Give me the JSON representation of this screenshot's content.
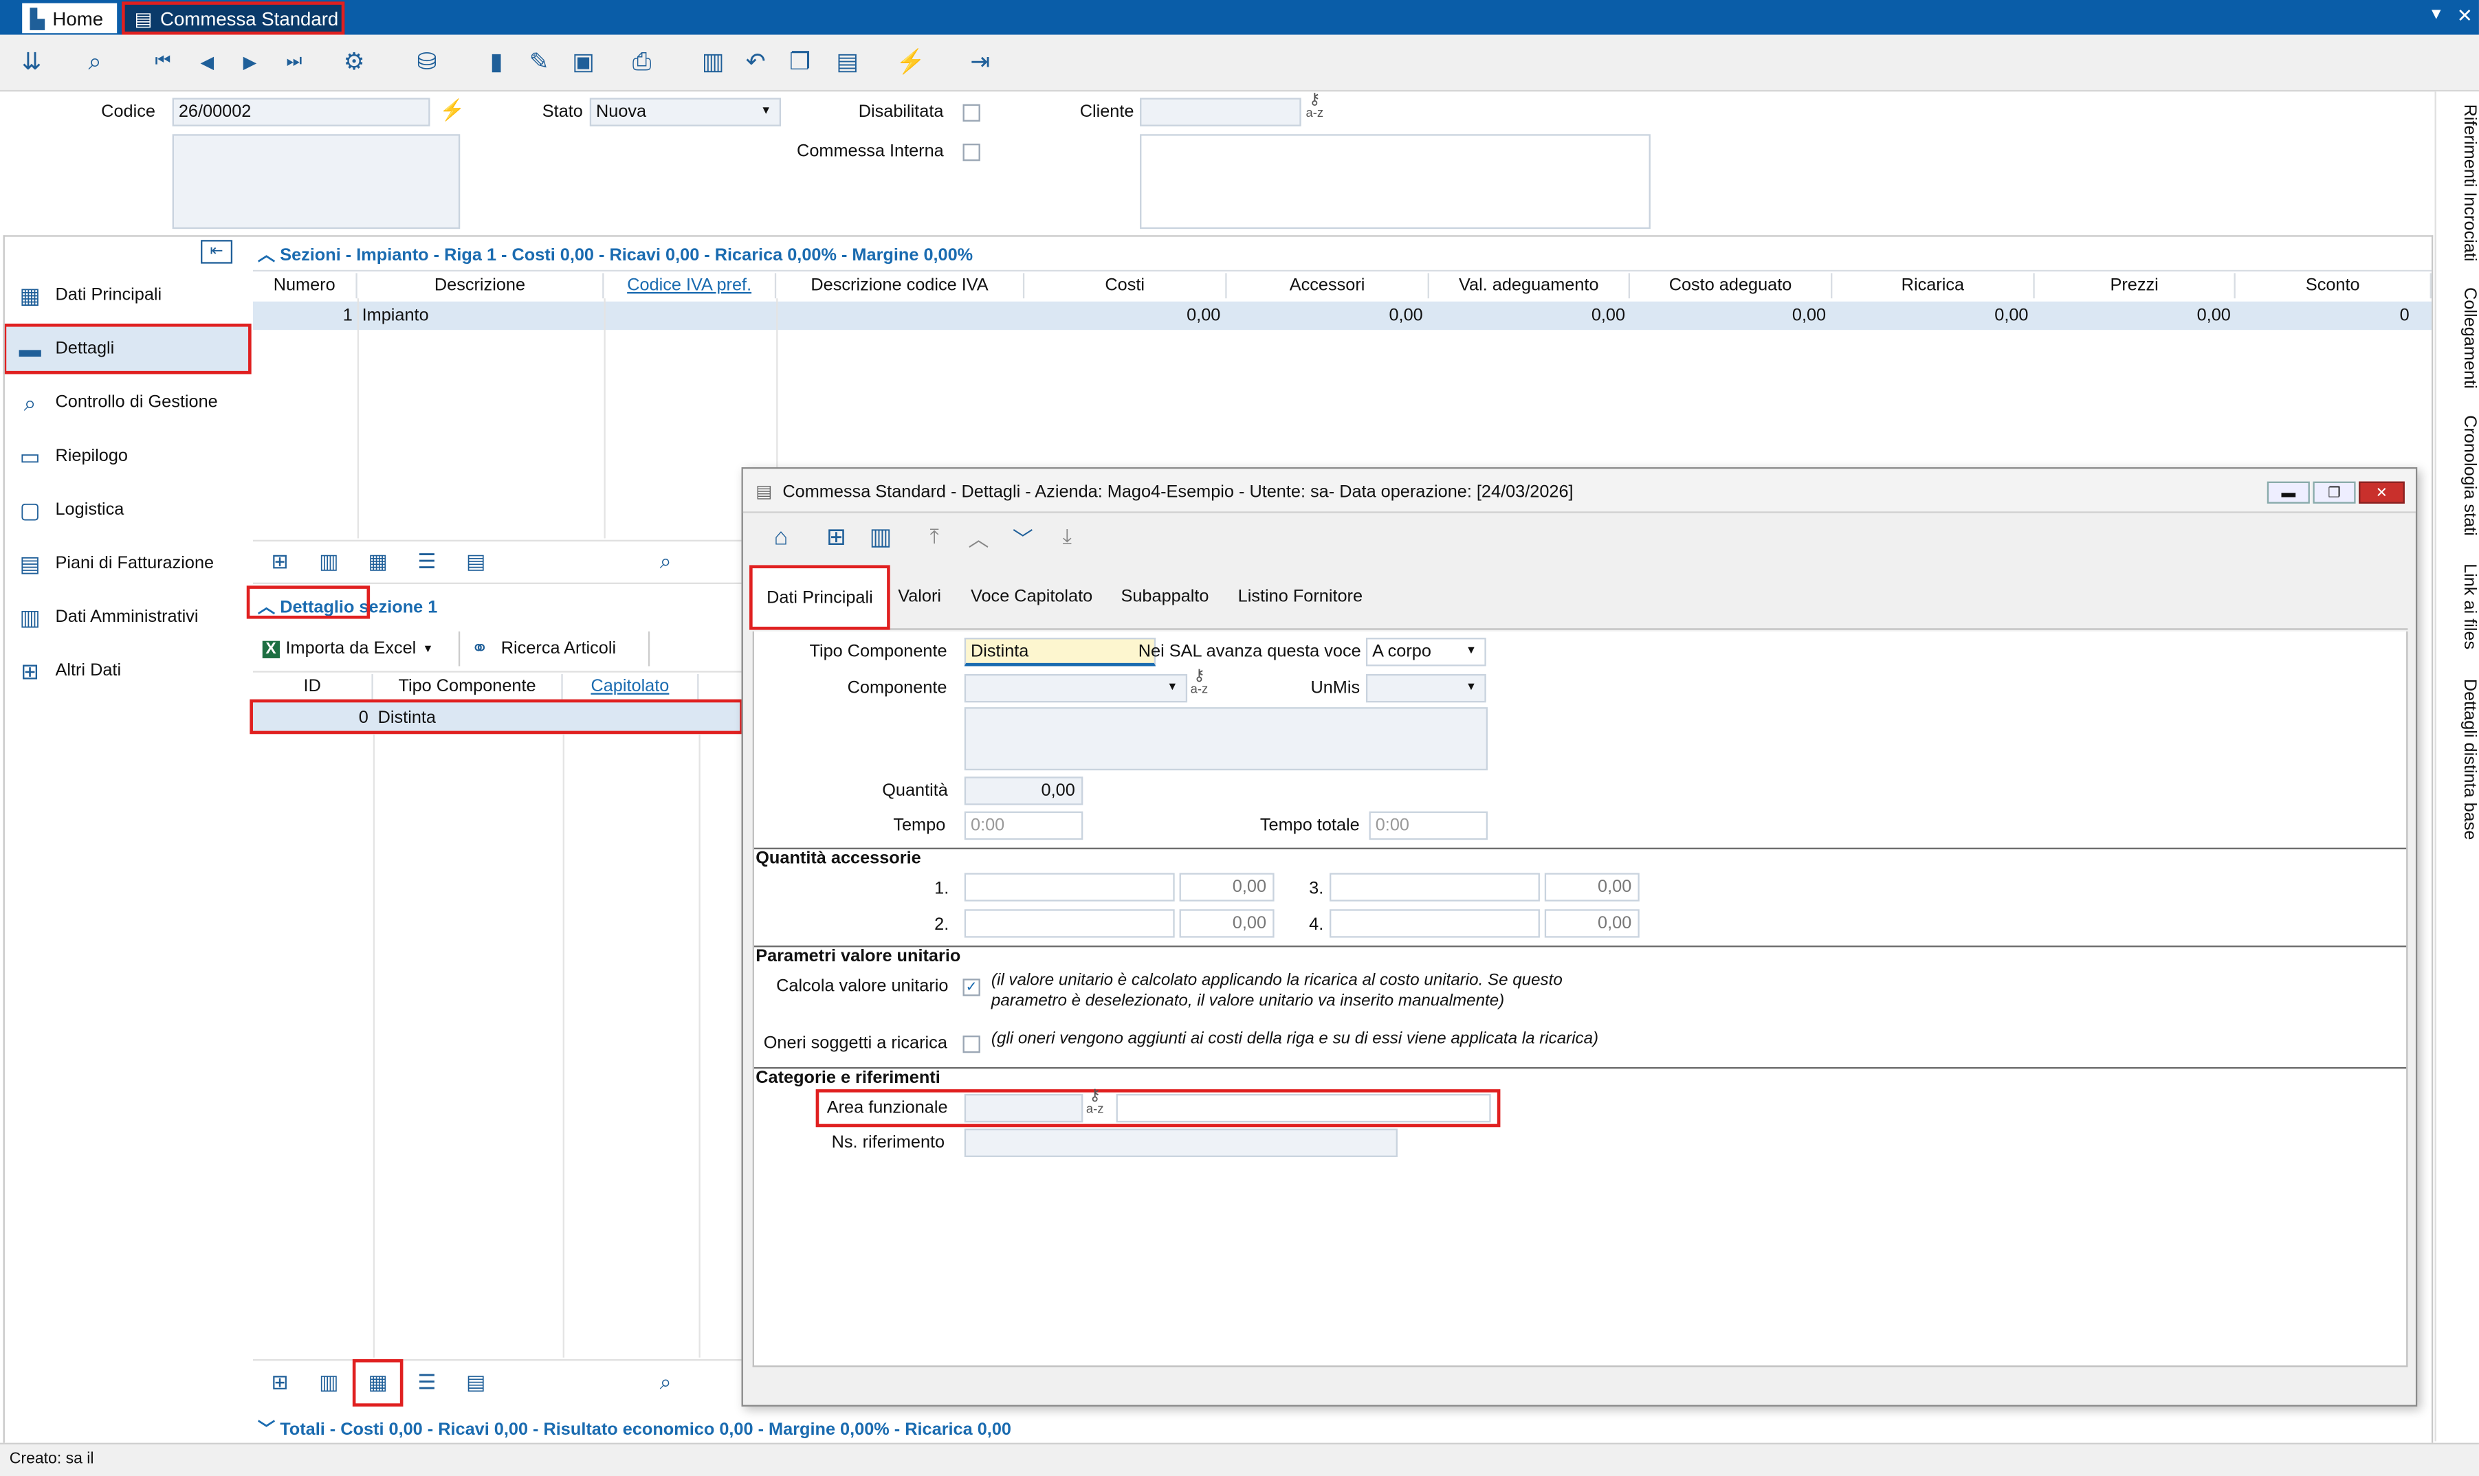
{
  "tabs": {
    "home": "Home",
    "active": "Commessa Standard"
  },
  "header": {
    "codice_label": "Codice",
    "codice_value": "26/00002",
    "stato_label": "Stato",
    "stato_value": "Nuova",
    "disabilitata_label": "Disabilitata",
    "commessa_interna_label": "Commessa Interna",
    "cliente_label": "Cliente",
    "az_label": "a-z"
  },
  "nav": {
    "items": [
      "Dati Principali",
      "Dettagli",
      "Controllo di Gestione",
      "Riepilogo",
      "Logistica",
      "Piani di Fatturazione",
      "Dati Amministrativi",
      "Altri Dati"
    ]
  },
  "sezioni": {
    "title": "Sezioni - Impianto - Riga 1 - Costi 0,00 - Ricavi 0,00 - Ricarica 0,00% - Margine 0,00%",
    "columns": [
      "Numero",
      "Descrizione",
      "Codice IVA pref.",
      "Descrizione codice IVA",
      "Costi",
      "Accessori",
      "Val. adeguamento",
      "Costo adeguato",
      "Ricarica",
      "Prezzi",
      "Sconto"
    ],
    "row": {
      "numero": "1",
      "descrizione": "Impianto",
      "costi": "0,00",
      "accessori": "0,00",
      "val_adeguamento": "0,00",
      "costo_adeguato": "0,00",
      "ricarica": "0,00",
      "prezzi": "0,00",
      "sconto": "0"
    }
  },
  "dettaglio": {
    "title": "Dettaglio sezione 1",
    "importa": "Importa da Excel",
    "ricerca": "Ricerca Articoli",
    "columns": [
      "ID",
      "Tipo Componente",
      "Capitolato"
    ],
    "row": {
      "id": "0",
      "tipo": "Distinta"
    }
  },
  "totali": "Totali - Costi 0,00 - Ricavi 0,00 - Risultato economico 0,00 - Margine 0,00% - Ricarica 0,00",
  "status": "Creato: sa il",
  "right_tabs": [
    "Riferimenti Incrociati",
    "Collegamenti",
    "Cronologia stati",
    "Link ai files",
    "Dettagli distinta base"
  ],
  "dialog": {
    "title": "Commessa Standard - Dettagli - Azienda: Mago4-Esempio - Utente: sa- Data operazione: [24/03/2026]",
    "tabs": [
      "Dati Principali",
      "Valori",
      "Voce Capitolato",
      "Subappalto",
      "Listino Fornitore"
    ],
    "tipo_componente_label": "Tipo Componente",
    "tipo_componente_value": "Distinta",
    "sal_label": "Nei SAL avanza questa voce",
    "sal_value": "A corpo",
    "componente_label": "Componente",
    "unmis_label": "UnMis",
    "quantita_label": "Quantità",
    "quantita_value": "0,00",
    "tempo_label": "Tempo",
    "tempo_value": "0:00",
    "tempo_totale_label": "Tempo totale",
    "tempo_totale_value": "0:00",
    "acc_title": "Quantità accessorie",
    "acc": [
      {
        "n": "1.",
        "v": "0,00"
      },
      {
        "n": "3.",
        "v": "0,00"
      },
      {
        "n": "2.",
        "v": "0,00"
      },
      {
        "n": "4.",
        "v": "0,00"
      }
    ],
    "param_title": "Parametri valore unitario",
    "calcola_label": "Calcola valore unitario",
    "calcola_note": "(il valore unitario è calcolato applicando la ricarica al costo unitario. Se questo parametro è deselezionato, il valore unitario va inserito manualmente)",
    "oneri_label": "Oneri soggetti a ricarica",
    "oneri_note": "(gli oneri vengono aggiunti ai costi della riga e su di essi viene applicata la ricarica)",
    "cat_title": "Categorie e riferimenti",
    "area_label": "Area funzionale",
    "ns_label": "Ns. riferimento"
  },
  "colors": {
    "titlebar": "#0a5da8",
    "highlight": "#e02020",
    "accent": "#1a6bb0",
    "selected_row": "#dbe7f3"
  }
}
